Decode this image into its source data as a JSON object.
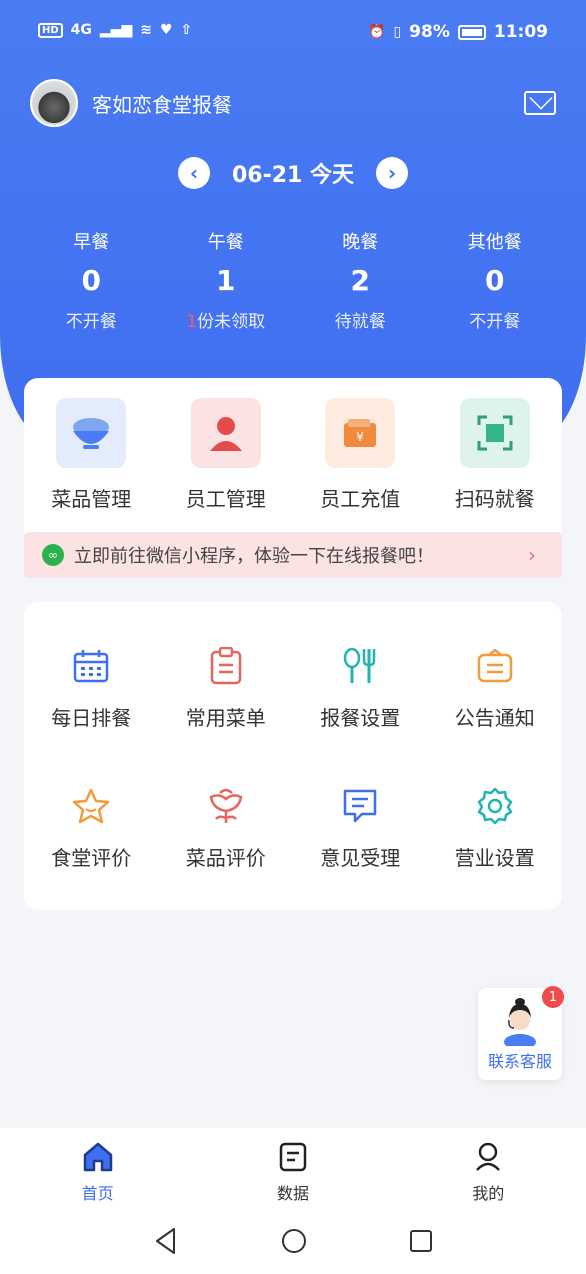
{
  "status_bar": {
    "network_box": "HD",
    "network": "4G",
    "battery": "98%",
    "time": "11:09"
  },
  "header": {
    "shop_name": "客如恋食堂报餐"
  },
  "datebar": {
    "date": "06-21",
    "today": "今天"
  },
  "meals": [
    {
      "name": "早餐",
      "count": "0",
      "status": "不开餐"
    },
    {
      "name": "午餐",
      "count": "1",
      "status_highlight": "1",
      "status": "份未领取"
    },
    {
      "name": "晚餐",
      "count": "2",
      "status": "待就餐"
    },
    {
      "name": "其他餐",
      "count": "0",
      "status": "不开餐"
    }
  ],
  "quick_actions": [
    {
      "label": "菜品管理",
      "icon": "bowl-icon",
      "bg": "#e3ecfb"
    },
    {
      "label": "员工管理",
      "icon": "person-icon",
      "bg": "#fbe3e3"
    },
    {
      "label": "员工充值",
      "icon": "wallet-icon",
      "bg": "#fdebe0"
    },
    {
      "label": "扫码就餐",
      "icon": "scan-icon",
      "bg": "#ddf3ec"
    }
  ],
  "banner": {
    "text": "立即前往微信小程序，体验一下在线报餐吧！",
    "arrow": "›"
  },
  "features": [
    {
      "label": "每日排餐",
      "icon": "calendar-icon"
    },
    {
      "label": "常用菜单",
      "icon": "clipboard-icon"
    },
    {
      "label": "报餐设置",
      "icon": "utensils-icon"
    },
    {
      "label": "公告通知",
      "icon": "notice-icon"
    },
    {
      "label": "食堂评价",
      "icon": "star-icon"
    },
    {
      "label": "菜品评价",
      "icon": "flower-icon"
    },
    {
      "label": "意见受理",
      "icon": "message-icon"
    },
    {
      "label": "营业设置",
      "icon": "gear-icon"
    }
  ],
  "support": {
    "label": "联系客服",
    "badge": "1"
  },
  "tabs": [
    {
      "label": "首页",
      "icon": "home-icon",
      "active": true
    },
    {
      "label": "数据",
      "icon": "document-icon",
      "active": false
    },
    {
      "label": "我的",
      "icon": "profile-icon",
      "active": false
    }
  ],
  "colors": {
    "primary": "#3f6ef0",
    "red": "#f04a4a",
    "cyan": "#22b3b3",
    "orange": "#f39a3a",
    "coral": "#e6665c"
  }
}
